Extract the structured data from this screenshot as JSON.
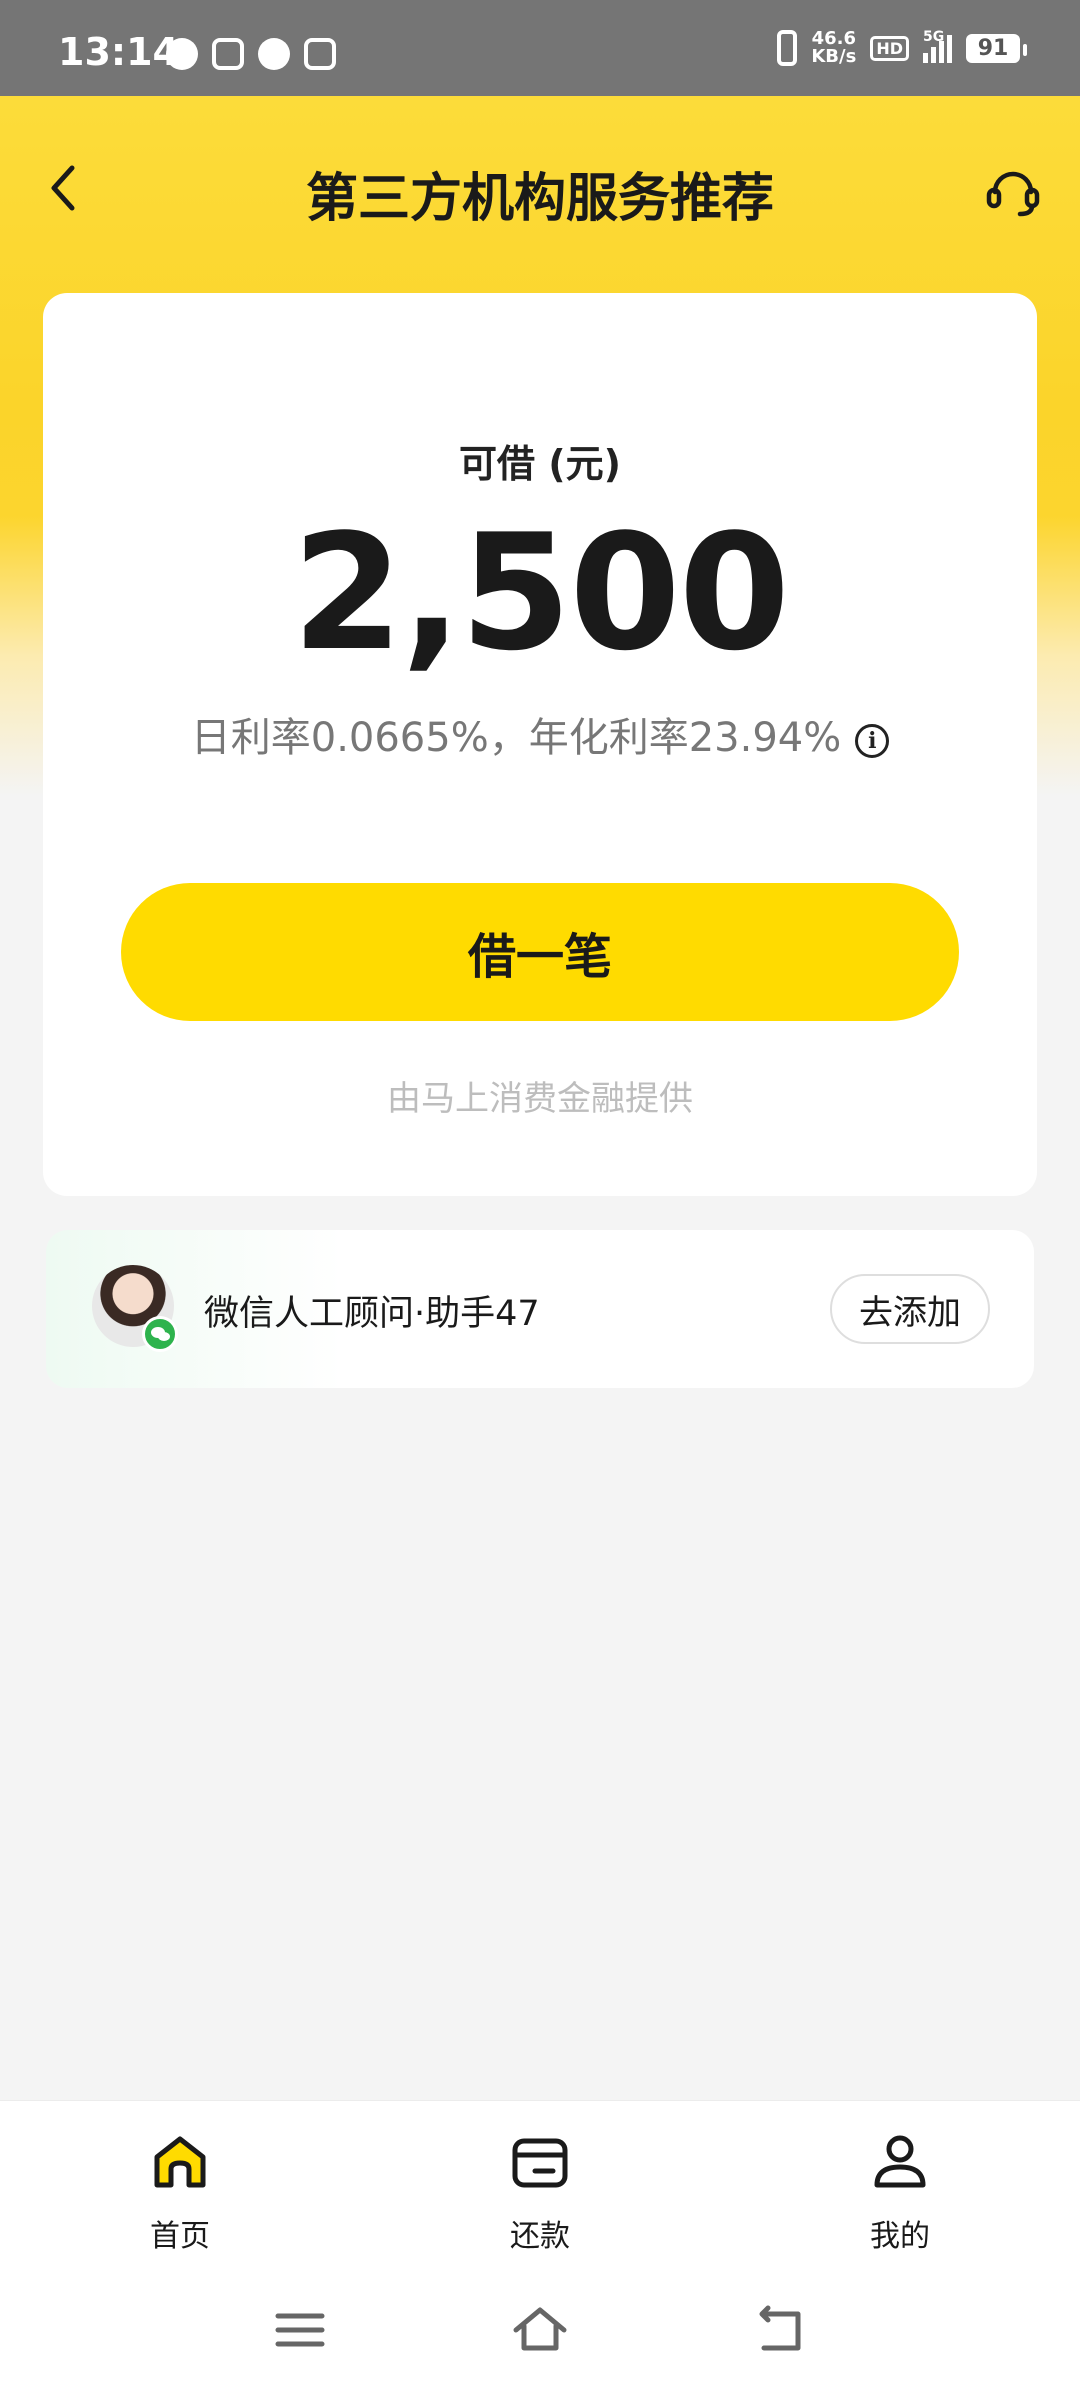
{
  "status_bar": {
    "time": "13:14",
    "net_speed_value": "46.6",
    "net_speed_unit": "KB/s",
    "hd": "HD",
    "network": "5G",
    "battery": "91"
  },
  "header": {
    "title": "第三方机构服务推荐"
  },
  "loan_card": {
    "label": "可借 (元)",
    "amount": "2,500",
    "rate_text": "日利率0.0665%，年化利率23.94%",
    "info_glyph": "i",
    "borrow_button": "借一笔",
    "provider_text": "由马上消费金融提供"
  },
  "advisor": {
    "name": "微信人工顾问·助手47",
    "add_button": "去添加"
  },
  "tab_bar": {
    "items": [
      {
        "label": "首页",
        "icon": "home-icon",
        "active": true
      },
      {
        "label": "还款",
        "icon": "wallet-icon",
        "active": false
      },
      {
        "label": "我的",
        "icon": "profile-icon",
        "active": false
      }
    ]
  },
  "colors": {
    "accent_yellow": "#ffdb00",
    "header_yellow": "#fbd42a",
    "background": "#f4f4f4",
    "wechat_green": "#2eb34d"
  }
}
